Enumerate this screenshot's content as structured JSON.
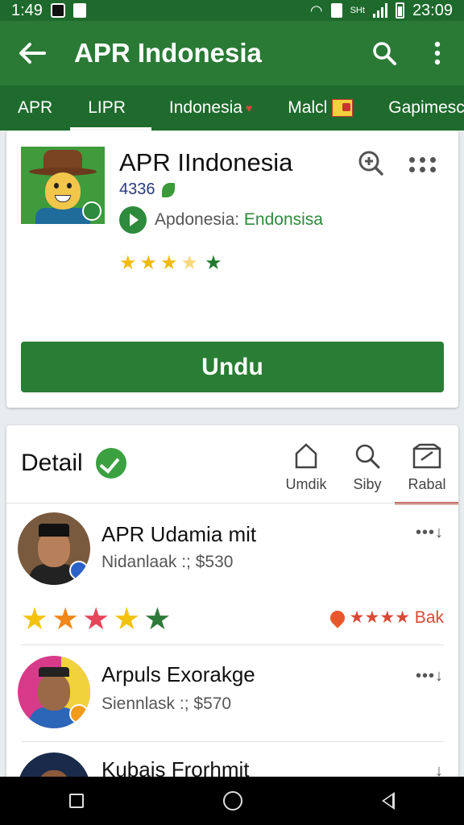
{
  "status_bar": {
    "time_left": "1:49",
    "time_right": "23:09",
    "network_label": "SHt"
  },
  "app_bar": {
    "title": "APR Indonesia",
    "back_icon": "arrow-left-icon",
    "search_icon": "search-icon",
    "menu_icon": "more-vert-icon"
  },
  "tabs": [
    {
      "label": "APR"
    },
    {
      "label": "LIPR"
    },
    {
      "label": "Indonesia"
    },
    {
      "label": "Malcl"
    },
    {
      "label": "Gapimesc"
    }
  ],
  "app_card": {
    "title": "APR IIndonesia",
    "meta": "4336",
    "developer_prefix": "Apdonesia: ",
    "developer_link": "Endonsisa",
    "rating_stars": 3.5,
    "install_button": "Undu"
  },
  "detail": {
    "title": "Detail",
    "side_tabs": [
      {
        "label": "Umdik",
        "icon": "home-icon"
      },
      {
        "label": "Siby",
        "icon": "search-icon"
      },
      {
        "label": "Rabal",
        "icon": "tray-icon"
      }
    ],
    "rows": [
      {
        "name": "APR Udamia mit",
        "subtitle": "Nidanlaak :; $530",
        "more": "•••↓",
        "tag": "★★★★ Bak"
      },
      {
        "name": "Arpuls Exorakge",
        "subtitle": "Siennlask :; $570",
        "more": "•••↓"
      },
      {
        "name": "Kubais Frorhmit",
        "more": "↓"
      }
    ]
  },
  "colors": {
    "primary": "#2a7a36",
    "primary_dark": "#1d6a2c",
    "accent_red": "#b33a2e",
    "star_yellow": "#f2b90f"
  }
}
